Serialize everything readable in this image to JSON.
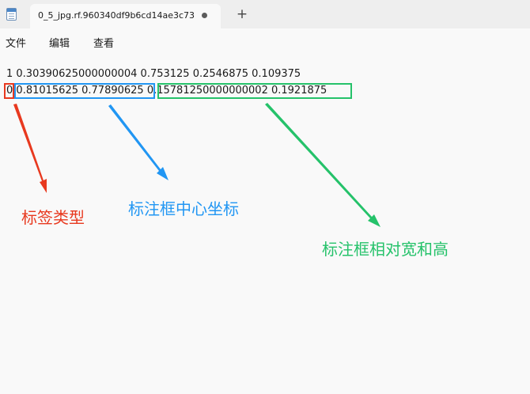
{
  "tab": {
    "title": "0_5_jpg.rf.960340df9b6cd14ae3c73",
    "new_tab_label": "+"
  },
  "menu": {
    "items": [
      "文件",
      "编辑",
      "查看"
    ]
  },
  "editor": {
    "line1": "1 0.30390625000000004 0.753125 0.2546875 0.109375",
    "line2": {
      "class_id": "0",
      "center": "0.81015625 0.77890625",
      "size": "0.15781250000000002 0.1921875"
    }
  },
  "annotations": {
    "class_label": "标签类型",
    "center_label": "标注框中心坐标",
    "size_label": "标注框相对宽和高"
  },
  "colors": {
    "red": "#e8391f",
    "blue": "#2196f3",
    "green": "#25c26a"
  }
}
